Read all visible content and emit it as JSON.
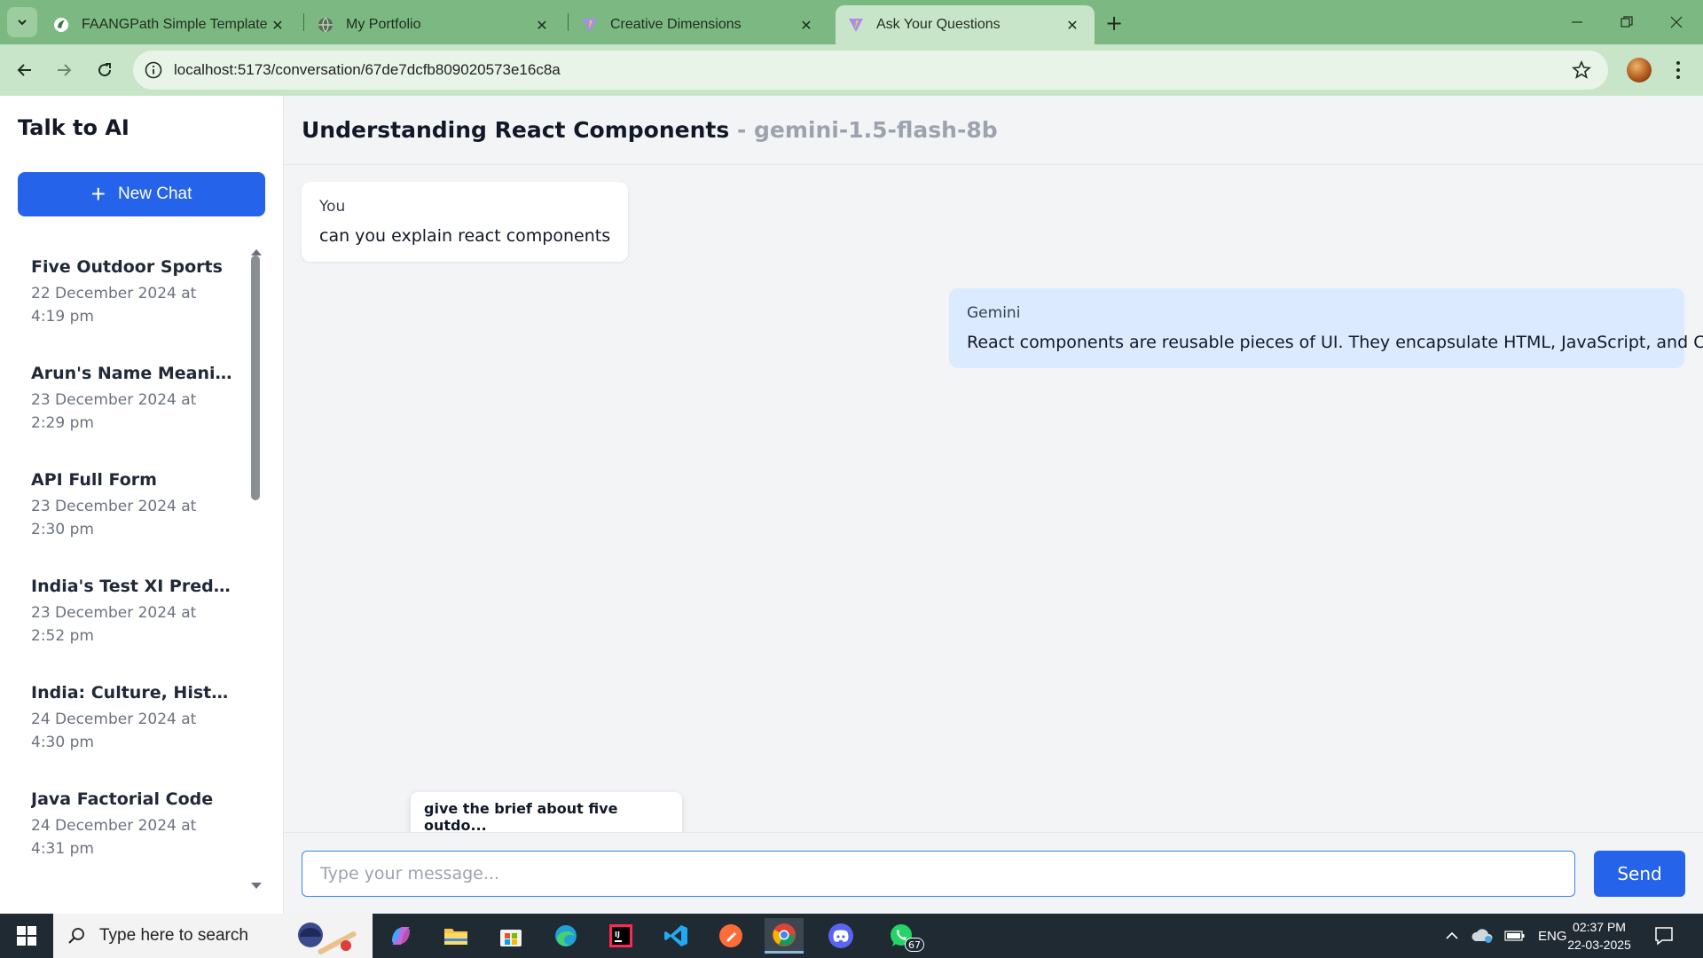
{
  "browser": {
    "tabs": [
      {
        "title": "FAANGPath Simple Template - C",
        "icon": "overleaf-icon",
        "active": false
      },
      {
        "title": "My Portfolio",
        "icon": "globe-icon",
        "active": false
      },
      {
        "title": "Creative Dimensions",
        "icon": "vite-icon",
        "active": false
      },
      {
        "title": "Ask Your Questions",
        "icon": "vite-icon",
        "active": true
      }
    ],
    "url": "localhost:5173/conversation/67de7dcfb809020573e16c8a"
  },
  "sidebar": {
    "title": "Talk to AI",
    "new_chat_label": "New Chat",
    "conversations": [
      {
        "title": "Five Outdoor Sports",
        "date": "22 December 2024 at 4:19 pm"
      },
      {
        "title": "Arun's Name Meaning",
        "date": "23 December 2024 at 2:29 pm"
      },
      {
        "title": "API Full Form",
        "date": "23 December 2024 at 2:30 pm"
      },
      {
        "title": "India's Test XI Prediction",
        "date": "23 December 2024 at 2:52 pm"
      },
      {
        "title": "India: Culture, History, ...",
        "date": "24 December 2024 at 4:30 pm"
      },
      {
        "title": "Java Factorial Code",
        "date": "24 December 2024 at 4:31 pm"
      }
    ]
  },
  "chat": {
    "title": "Understanding React Components",
    "model": "- gemini-1.5-flash-8b",
    "messages": [
      {
        "sender": "You",
        "text": "can you explain react components"
      },
      {
        "sender": "Gemini",
        "text": "React components are reusable pieces of UI. They encapsulate HTML, JavaScript, and CSS."
      }
    ],
    "suggestion": "give the brief about five outdo...",
    "input_placeholder": "Type your message...",
    "input_value": "",
    "send_label": "Send"
  },
  "taskbar": {
    "search_placeholder": "Type here to search",
    "whatsapp_badge": "67",
    "language": "ENG",
    "time": "02:37 PM",
    "date": "22-03-2025"
  },
  "colors": {
    "accent": "#2563eb",
    "ai_bubble": "#dbeafe",
    "browser_frame": "#7cb982"
  }
}
